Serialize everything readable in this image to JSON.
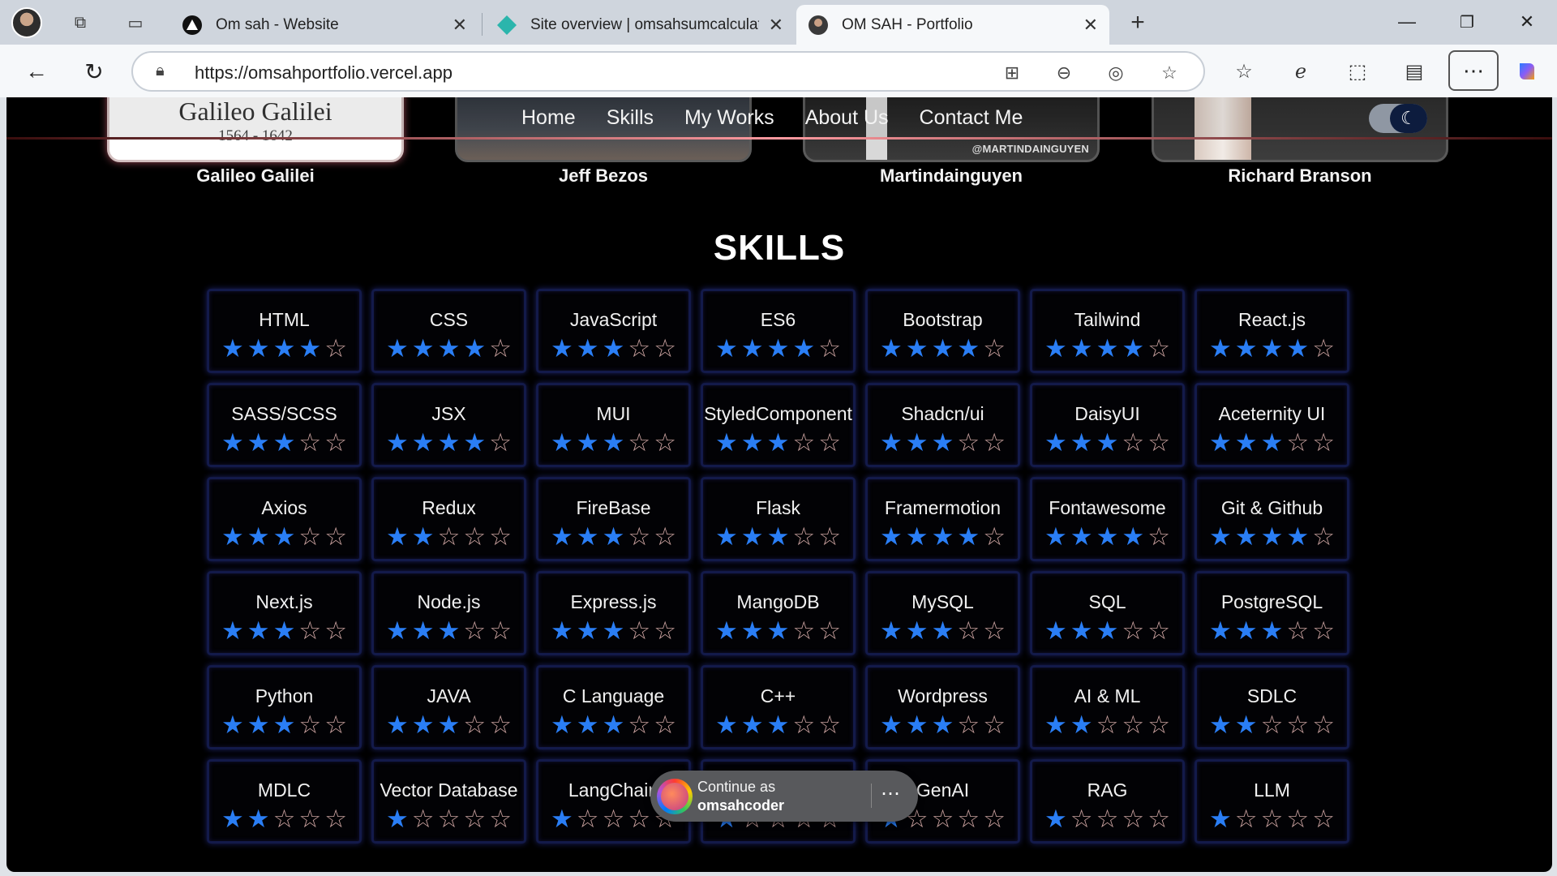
{
  "browser": {
    "tabs": [
      {
        "title": "Om sah - Website",
        "active": false
      },
      {
        "title": "Site overview | omsahsumcalculat",
        "active": false
      },
      {
        "title": "OM SAH - Portfolio",
        "active": true
      }
    ],
    "url": "https://omsahportfolio.vercel.app"
  },
  "hero": {
    "galileo_card": {
      "name": "Galileo Galilei",
      "years": "1564 - 1642"
    },
    "martin_handle": "@MARTINDAINGUYEN",
    "people": [
      "Galileo Galilei",
      "Jeff Bezos",
      "Martindainguyen",
      "Richard Branson"
    ]
  },
  "nav": {
    "links": [
      "Home",
      "Skills",
      "My Works",
      "About Us",
      "Contact Me"
    ],
    "theme_toggle": "dark"
  },
  "skills": {
    "title": "SKILLS",
    "max_rating": 5,
    "items": [
      {
        "name": "HTML",
        "rating": 4
      },
      {
        "name": "CSS",
        "rating": 4
      },
      {
        "name": "JavaScript",
        "rating": 3
      },
      {
        "name": "ES6",
        "rating": 4
      },
      {
        "name": "Bootstrap",
        "rating": 4
      },
      {
        "name": "Tailwind",
        "rating": 4
      },
      {
        "name": "React.js",
        "rating": 4
      },
      {
        "name": "SASS/SCSS",
        "rating": 3
      },
      {
        "name": "JSX",
        "rating": 4
      },
      {
        "name": "MUI",
        "rating": 3
      },
      {
        "name": "StyledComponent",
        "rating": 3
      },
      {
        "name": "Shadcn/ui",
        "rating": 3
      },
      {
        "name": "DaisyUI",
        "rating": 3
      },
      {
        "name": "Aceternity UI",
        "rating": 3
      },
      {
        "name": "Axios",
        "rating": 3
      },
      {
        "name": "Redux",
        "rating": 2
      },
      {
        "name": "FireBase",
        "rating": 3
      },
      {
        "name": "Flask",
        "rating": 3
      },
      {
        "name": "Framermotion",
        "rating": 4
      },
      {
        "name": "Fontawesome",
        "rating": 4
      },
      {
        "name": "Git & Github",
        "rating": 4
      },
      {
        "name": "Next.js",
        "rating": 3
      },
      {
        "name": "Node.js",
        "rating": 3
      },
      {
        "name": "Express.js",
        "rating": 3
      },
      {
        "name": "MangoDB",
        "rating": 3
      },
      {
        "name": "MySQL",
        "rating": 3
      },
      {
        "name": "SQL",
        "rating": 3
      },
      {
        "name": "PostgreSQL",
        "rating": 3
      },
      {
        "name": "Python",
        "rating": 3
      },
      {
        "name": "JAVA",
        "rating": 3
      },
      {
        "name": "C Language",
        "rating": 3
      },
      {
        "name": "C++",
        "rating": 3
      },
      {
        "name": "Wordpress",
        "rating": 3
      },
      {
        "name": "AI & ML",
        "rating": 2
      },
      {
        "name": "SDLC",
        "rating": 2
      },
      {
        "name": "MDLC",
        "rating": 2
      },
      {
        "name": "Vector Database",
        "rating": 1
      },
      {
        "name": "LangChain",
        "rating": 1
      },
      {
        "name": "",
        "rating": 1
      },
      {
        "name": "GenAI",
        "rating": 1
      },
      {
        "name": "RAG",
        "rating": 1
      },
      {
        "name": "LLM",
        "rating": 1
      }
    ]
  },
  "toast": {
    "line1": "Continue as",
    "username": "omsahcoder"
  }
}
